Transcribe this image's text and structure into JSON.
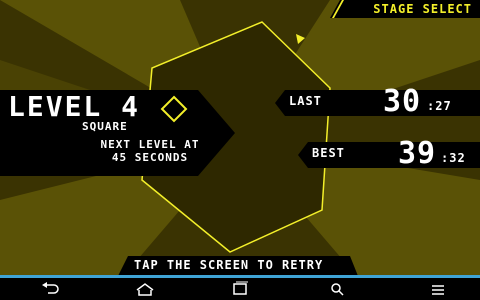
{
  "stage_select": {
    "label": "STAGE SELECT"
  },
  "level": {
    "title": "LEVEL 4",
    "shape_name": "SQUARE",
    "next_level_line1": "NEXT LEVEL AT",
    "next_level_line2": "45 SECONDS"
  },
  "scores": {
    "last": {
      "label": "LAST",
      "seconds": "30",
      "frames": ":27"
    },
    "best": {
      "label": "BEST",
      "seconds": "39",
      "frames": ":32"
    }
  },
  "tap_prompt": "TAP THE SCREEN TO RETRY",
  "colors": {
    "accent_yellow": "#f3ef2a",
    "background_dark": "#2a2500",
    "background_light": "#5c5405",
    "nav_accent": "#3fa4d6"
  },
  "nav": {
    "icons": [
      "back-icon",
      "home-icon",
      "recents-icon",
      "search-icon",
      "menu-icon"
    ]
  }
}
